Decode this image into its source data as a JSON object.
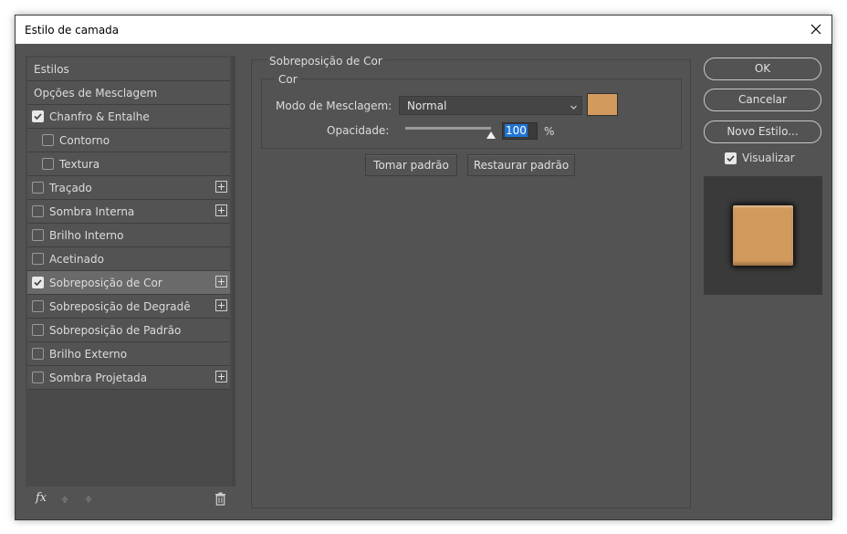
{
  "window": {
    "title": "Estilo de camada"
  },
  "styles_list": [
    {
      "label": "Estilos",
      "checkbox": false,
      "checked": false,
      "plus": false,
      "sub": false,
      "selected": false
    },
    {
      "label": "Opções de Mesclagem",
      "checkbox": false,
      "checked": false,
      "plus": false,
      "sub": false,
      "selected": false
    },
    {
      "label": "Chanfro & Entalhe",
      "checkbox": true,
      "checked": true,
      "plus": false,
      "sub": false,
      "selected": false
    },
    {
      "label": "Contorno",
      "checkbox": true,
      "checked": false,
      "plus": false,
      "sub": true,
      "selected": false
    },
    {
      "label": "Textura",
      "checkbox": true,
      "checked": false,
      "plus": false,
      "sub": true,
      "selected": false
    },
    {
      "label": "Traçado",
      "checkbox": true,
      "checked": false,
      "plus": true,
      "sub": false,
      "selected": false
    },
    {
      "label": "Sombra Interna",
      "checkbox": true,
      "checked": false,
      "plus": true,
      "sub": false,
      "selected": false
    },
    {
      "label": "Brilho Interno",
      "checkbox": true,
      "checked": false,
      "plus": false,
      "sub": false,
      "selected": false
    },
    {
      "label": "Acetinado",
      "checkbox": true,
      "checked": false,
      "plus": false,
      "sub": false,
      "selected": false
    },
    {
      "label": "Sobreposição de Cor",
      "checkbox": true,
      "checked": true,
      "plus": true,
      "sub": false,
      "selected": true
    },
    {
      "label": "Sobreposição de Degradê",
      "checkbox": true,
      "checked": false,
      "plus": true,
      "sub": false,
      "selected": false
    },
    {
      "label": "Sobreposição de Padrão",
      "checkbox": true,
      "checked": false,
      "plus": false,
      "sub": false,
      "selected": false
    },
    {
      "label": "Brilho Externo",
      "checkbox": true,
      "checked": false,
      "plus": false,
      "sub": false,
      "selected": false
    },
    {
      "label": "Sombra Projetada",
      "checkbox": true,
      "checked": false,
      "plus": true,
      "sub": false,
      "selected": false
    }
  ],
  "footer": {
    "fx_label": "fx"
  },
  "panel": {
    "group_title": "Sobreposição de Cor",
    "subgroup_title": "Cor",
    "blend_mode_label": "Modo de Mesclagem:",
    "blend_mode_value": "Normal",
    "swatch_color": "#d39a5e",
    "opacity_label": "Opacidade:",
    "opacity_value": "100",
    "opacity_fraction": 1.0,
    "opacity_unit": "%",
    "make_default_label": "Tomar padrão",
    "reset_default_label": "Restaurar padrão"
  },
  "actions": {
    "ok_label": "OK",
    "cancel_label": "Cancelar",
    "new_style_label": "Novo Estilo...",
    "preview_label": "Visualizar",
    "preview_checked": true
  },
  "colors": {
    "accent": "#1f74d4",
    "dialog_bg": "#535353",
    "overlay_color": "#d39a5e"
  }
}
